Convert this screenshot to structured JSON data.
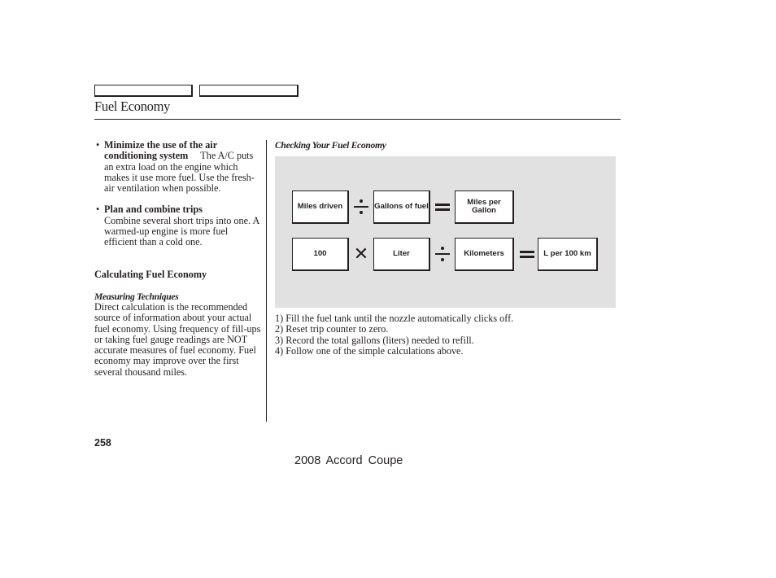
{
  "header": {
    "tabs": [
      "",
      ""
    ],
    "title": "Fuel Economy"
  },
  "left_column": {
    "bullets": [
      {
        "lead": "Minimize the use of the air conditioning system",
        "text": "The A/C puts an extra load on the engine which makes it use more fuel. Use the fresh-air ventilation when possible."
      },
      {
        "lead": "Plan and combine trips",
        "text": "Combine several short trips into one. A warmed-up engine is more fuel efficient than a cold one."
      }
    ],
    "calc_heading": "Calculating Fuel Economy",
    "measure_heading": "Measuring Techniques",
    "measure_body": "Direct calculation is the recommended source of information about your actual fuel economy. Using frequency of fill-ups or taking fuel gauge readings are NOT accurate measures of fuel economy. Fuel economy may improve over the first several thousand miles."
  },
  "right_column": {
    "heading": "Checking Your Fuel Economy",
    "formula_1": {
      "operand_1": "Miles driven",
      "operator_1": "divide",
      "operand_2": "Gallons of fuel",
      "operator_2": "equals",
      "result": "Miles per Gallon"
    },
    "formula_2": {
      "operand_1": "100",
      "operator_1": "multiply",
      "operand_2": "Liter",
      "operator_2": "divide",
      "operand_3": "Kilometers",
      "operator_3": "equals",
      "result": "L per 100 km"
    },
    "symbols": {
      "multiply": "✕"
    },
    "steps": [
      "1) Fill the fuel tank until the nozzle automatically clicks off.",
      "2) Reset trip counter to zero.",
      "3) Record the total gallons (liters) needed to refill.",
      "4) Follow one of the simple calculations above."
    ]
  },
  "footer": {
    "page_number": "258",
    "model": "2008  Accord  Coupe"
  }
}
